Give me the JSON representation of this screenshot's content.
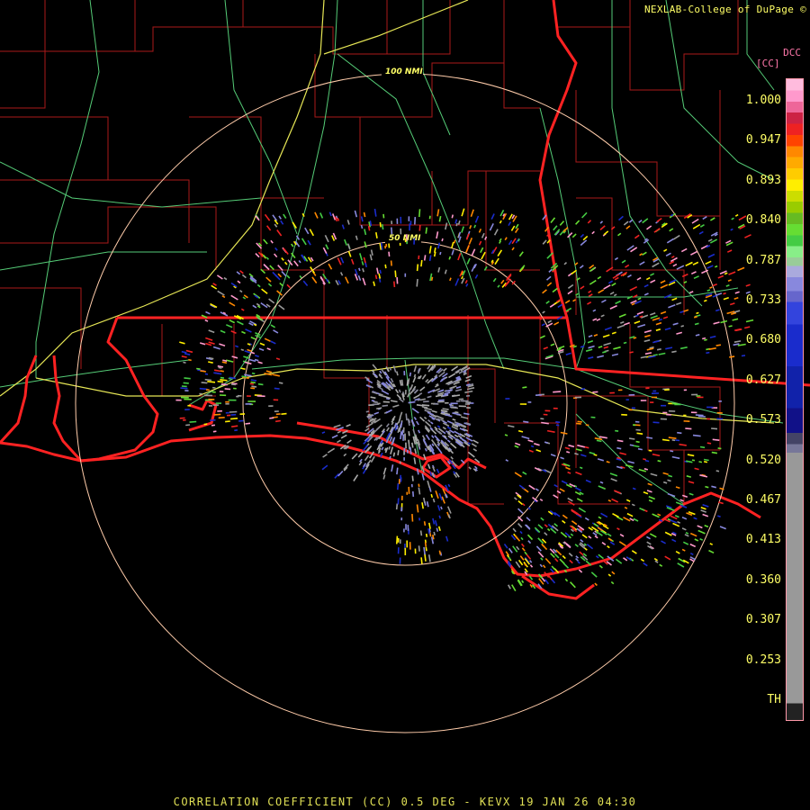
{
  "map": {
    "credit": "NEXLAB-College of DuPage ©",
    "product_code": "DCC",
    "unit": "[CC]",
    "footer": "CORRELATION COEFFICIENT (CC) 0.5 DEG - KEVX 19 JAN 26 04:30",
    "range_rings": [
      {
        "label": "50 NMI"
      },
      {
        "label": "100 NMI"
      }
    ],
    "colorbar": {
      "ticks": [
        "1.000",
        "0.947",
        "0.893",
        "0.840",
        "0.787",
        "0.733",
        "0.680",
        "0.627",
        "0.573",
        "0.520",
        "0.467",
        "0.413",
        "0.360",
        "0.307",
        "0.253",
        "TH"
      ],
      "colors": {
        "pink": "#ff99cc",
        "red": "#ee2222",
        "orange": "#ff8800",
        "yellow": "#ffee00",
        "green": "#66dd33",
        "lavender": "#8888dd",
        "blue": "#1a2ccc",
        "gray": "#999999",
        "coast": "#ff2222",
        "county": "#cc2222",
        "road": "#55cc77",
        "interstate": "#e6e655",
        "ring": "#ffccaa"
      }
    }
  }
}
